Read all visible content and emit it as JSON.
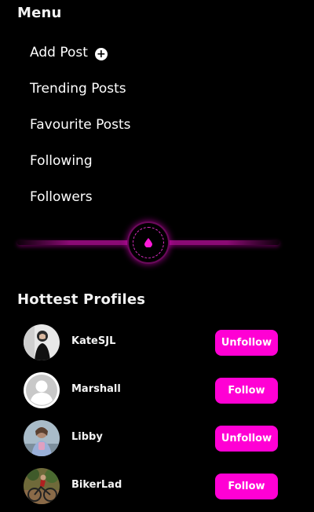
{
  "menu": {
    "heading": "Menu",
    "items": [
      {
        "label": "Add Post",
        "icon": "plus-circle-icon"
      },
      {
        "label": "Trending Posts"
      },
      {
        "label": "Favourite Posts"
      },
      {
        "label": "Following"
      },
      {
        "label": "Followers"
      }
    ],
    "plus_symbol": "+"
  },
  "divider": {
    "icon": "droplet-icon"
  },
  "hottest_profiles": {
    "heading": "Hottest Profiles",
    "profiles": [
      {
        "name": "KateSJL",
        "button": "Unfollow",
        "avatar": "photo"
      },
      {
        "name": "Marshall",
        "button": "Follow",
        "avatar": "default-user-icon"
      },
      {
        "name": "Libby",
        "button": "Unfollow",
        "avatar": "photo"
      },
      {
        "name": "BikerLad",
        "button": "Follow",
        "avatar": "photo"
      }
    ]
  },
  "colors": {
    "accent": "#ff00d4",
    "background": "#000000",
    "text": "#ffffff"
  }
}
